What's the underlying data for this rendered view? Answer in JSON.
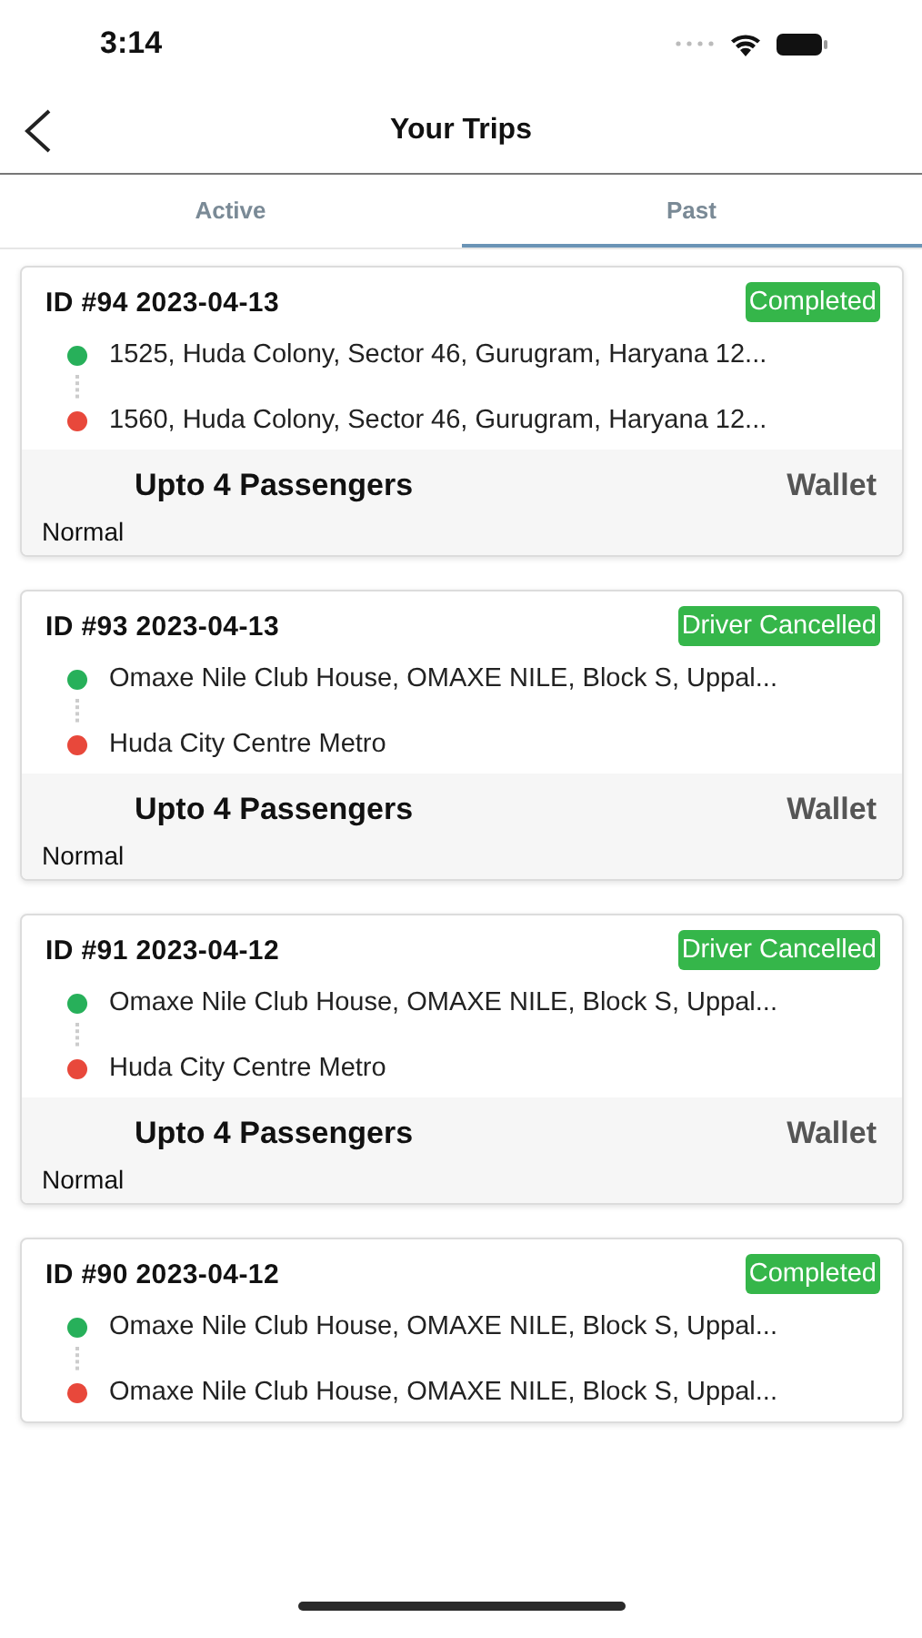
{
  "status_bar": {
    "time": "3:14"
  },
  "header": {
    "title": "Your Trips"
  },
  "tabs": [
    {
      "label": "Active",
      "selected": false
    },
    {
      "label": "Past",
      "selected": true
    }
  ],
  "trips": [
    {
      "title": "ID #94 2023-04-13",
      "status": "Completed",
      "stops": [
        {
          "kind": "pickup",
          "address": "1525, Huda Colony, Sector 46, Gurugram, Haryana 12..."
        },
        {
          "kind": "drop",
          "address": "1560, Huda Colony, Sector 46, Gurugram, Haryana 12..."
        }
      ],
      "passengers": "Upto 4 Passengers",
      "payment": "Wallet",
      "category": "Normal"
    },
    {
      "title": "ID #93 2023-04-13",
      "status": "Driver Cancelled",
      "stops": [
        {
          "kind": "pickup",
          "address": "Omaxe Nile Club House, OMAXE NILE, Block S, Uppal..."
        },
        {
          "kind": "drop",
          "address": "Huda City Centre Metro"
        }
      ],
      "passengers": "Upto 4 Passengers",
      "payment": "Wallet",
      "category": "Normal"
    },
    {
      "title": "ID #91 2023-04-12",
      "status": "Driver Cancelled",
      "stops": [
        {
          "kind": "pickup",
          "address": "Omaxe Nile Club House, OMAXE NILE, Block S, Uppal..."
        },
        {
          "kind": "drop",
          "address": "Huda City Centre Metro"
        }
      ],
      "passengers": "Upto 4 Passengers",
      "payment": "Wallet",
      "category": "Normal"
    },
    {
      "title": "ID #90 2023-04-12",
      "status": "Completed",
      "stops": [
        {
          "kind": "pickup",
          "address": "Omaxe Nile Club House, OMAXE NILE, Block S, Uppal..."
        },
        {
          "kind": "drop",
          "address": "Omaxe Nile Club House, OMAXE NILE, Block S, Uppal..."
        }
      ]
    }
  ]
}
